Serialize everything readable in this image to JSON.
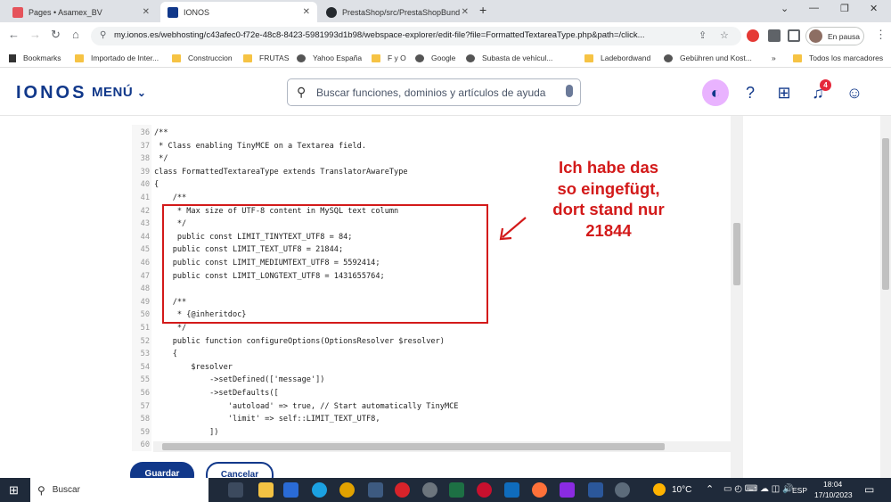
{
  "browser": {
    "tabs": [
      {
        "label": "Pages • Asamex_BV"
      },
      {
        "label": "IONOS"
      },
      {
        "label": "PrestaShop/src/PrestaShopBund"
      }
    ],
    "url": "my.ionos.es/webhosting/c43afec0-f72e-48c8-8423-5981993d1b98/webspace-explorer/edit-file?file=FormattedTextareaType.php&path=/click...",
    "profile_status": "En pausa",
    "bookmarks": [
      "Bookmarks",
      "Importado de Inter...",
      "Construccion",
      "FRUTAS",
      "Yahoo España",
      "F y O",
      "Google",
      "Subasta de vehícul...",
      "Ladebordwand",
      "Gebühren und Kost...",
      "Todos los marcadores"
    ]
  },
  "ionos": {
    "logo": "IONOS",
    "menu_label": "MENÚ",
    "search_placeholder": "Buscar funciones, dominios y artículos de ayuda",
    "notification_count": "4"
  },
  "editor": {
    "lines": [
      {
        "num": "36",
        "code": "/**"
      },
      {
        "num": "37",
        "code": " * Class enabling TinyMCE on a Textarea field."
      },
      {
        "num": "38",
        "code": " */"
      },
      {
        "num": "39",
        "code": "class FormattedTextareaType extends TranslatorAwareType"
      },
      {
        "num": "40",
        "code": "{"
      },
      {
        "num": "41",
        "code": "    /**"
      },
      {
        "num": "42",
        "code": "     * Max size of UTF-8 content in MySQL text column"
      },
      {
        "num": "43",
        "code": "     */"
      },
      {
        "num": "44",
        "code": "     public const LIMIT_TINYTEXT_UTF8 = 84;"
      },
      {
        "num": "45",
        "code": "    public const LIMIT_TEXT_UTF8 = 21844;"
      },
      {
        "num": "46",
        "code": "    public const LIMIT_MEDIUMTEXT_UTF8 = 5592414;"
      },
      {
        "num": "47",
        "code": "    public const LIMIT_LONGTEXT_UTF8 = 1431655764;"
      },
      {
        "num": "48",
        "code": ""
      },
      {
        "num": "49",
        "code": "    /**"
      },
      {
        "num": "50",
        "code": "     * {@inheritdoc}"
      },
      {
        "num": "51",
        "code": "     */"
      },
      {
        "num": "52",
        "code": "    public function configureOptions(OptionsResolver $resolver)"
      },
      {
        "num": "53",
        "code": "    {"
      },
      {
        "num": "54",
        "code": "        $resolver"
      },
      {
        "num": "55",
        "code": "            ->setDefined(['message'])"
      },
      {
        "num": "56",
        "code": "            ->setDefaults(["
      },
      {
        "num": "57",
        "code": "                'autoload' => true, // Start automatically TinyMCE"
      },
      {
        "num": "58",
        "code": "                'limit' => self::LIMIT_TEXT_UTF8,"
      },
      {
        "num": "59",
        "code": "            ])"
      },
      {
        "num": "60",
        "code": ""
      }
    ]
  },
  "annotation": {
    "lines": [
      "Ich habe das",
      "so eingefügt,",
      "dort stand nur",
      "21844"
    ],
    "color": "#d31a1a"
  },
  "actions": {
    "save_label": "Guardar",
    "cancel_label": "Cancelar"
  },
  "taskbar": {
    "search_label": "Buscar",
    "weather": "10°C",
    "language": "ESP",
    "time": "18:04",
    "date": "17/10/2023"
  }
}
